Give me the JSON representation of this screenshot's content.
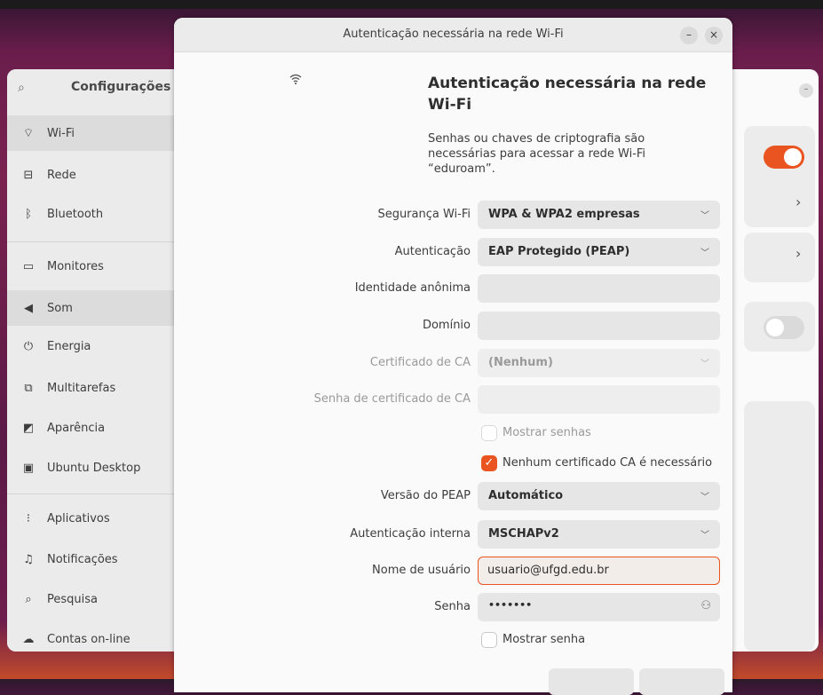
{
  "settings": {
    "title": "Configurações",
    "sidebar": [
      {
        "icon": "wifi-icon",
        "glyph": "⌔",
        "label": "Wi-Fi",
        "active": true
      },
      {
        "icon": "network-icon",
        "glyph": "⊟",
        "label": "Rede"
      },
      {
        "icon": "bluetooth-icon",
        "glyph": "ᛒ",
        "label": "Bluetooth"
      },
      {
        "icon": "monitor-icon",
        "glyph": "▭",
        "label": "Monitores"
      },
      {
        "icon": "speaker-icon",
        "glyph": "◀",
        "label": "Som",
        "active": true
      },
      {
        "icon": "power-icon",
        "glyph": "⏻",
        "label": "Energia"
      },
      {
        "icon": "multitask-icon",
        "glyph": "⧉",
        "label": "Multitarefas"
      },
      {
        "icon": "appearance-icon",
        "glyph": "◩",
        "label": "Aparência"
      },
      {
        "icon": "ubuntu-desktop-icon",
        "glyph": "▣",
        "label": "Ubuntu Desktop"
      },
      {
        "icon": "apps-icon",
        "glyph": "⁝",
        "label": "Aplicativos"
      },
      {
        "icon": "bell-icon",
        "glyph": "♫",
        "label": "Notificações"
      },
      {
        "icon": "search-icon",
        "glyph": "⌕",
        "label": "Pesquisa"
      },
      {
        "icon": "cloud-icon",
        "glyph": "☁",
        "label": "Contas on-line"
      }
    ]
  },
  "dialog": {
    "window_title": "Autenticação necessária na rede Wi-Fi",
    "heading": "Autenticação necessária na rede Wi-Fi",
    "description": "Senhas ou chaves de criptografia são necessárias para acessar a rede Wi-Fi “eduroam”.",
    "minimize": "–",
    "close": "×",
    "fields": {
      "security": {
        "label": "Segurança Wi-Fi",
        "value": "WPA & WPA2 empresas"
      },
      "auth": {
        "label": "Autenticação",
        "value": "EAP Protegido (PEAP)"
      },
      "anon_identity": {
        "label": "Identidade anônima",
        "value": ""
      },
      "domain": {
        "label": "Domínio",
        "value": ""
      },
      "ca_cert": {
        "label": "Certificado de CA",
        "value": "(Nenhum)"
      },
      "ca_cert_password": {
        "label": "Senha de certificado de CA",
        "value": ""
      },
      "show_passwords": {
        "label": "Mostrar senhas",
        "checked": false
      },
      "no_ca_required": {
        "label": "Nenhum certificado CA é necessário",
        "checked": true
      },
      "peap_version": {
        "label": "Versão do PEAP",
        "value": "Automático"
      },
      "inner_auth": {
        "label": "Autenticação interna",
        "value": "MSCHAPv2"
      },
      "username": {
        "label": "Nome de usuário",
        "value": "usuario@ufgd.edu.br"
      },
      "password": {
        "label": "Senha",
        "value": "•••••••"
      },
      "show_password": {
        "label": "Mostrar senha",
        "checked": false
      }
    }
  },
  "colors": {
    "accent": "#e95420"
  }
}
